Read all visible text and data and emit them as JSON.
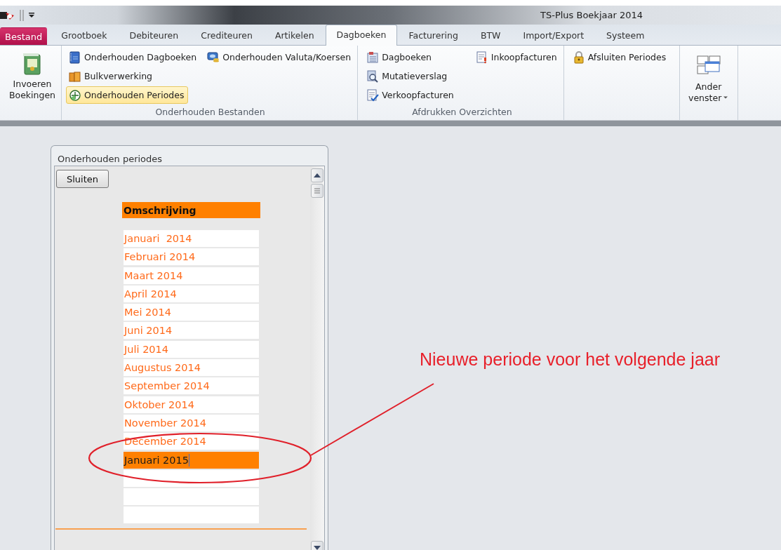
{
  "window": {
    "title": "TS-Plus Boekjaar 2014"
  },
  "ribbon": {
    "tabs": [
      {
        "label": "Bestand",
        "kind": "file",
        "selected": false
      },
      {
        "label": "Grootboek",
        "kind": "tab",
        "selected": false
      },
      {
        "label": "Debiteuren",
        "kind": "tab",
        "selected": false
      },
      {
        "label": "Crediteuren",
        "kind": "tab",
        "selected": false
      },
      {
        "label": "Artikelen",
        "kind": "tab",
        "selected": false
      },
      {
        "label": "Dagboeken",
        "kind": "tab",
        "selected": true
      },
      {
        "label": "Facturering",
        "kind": "tab",
        "selected": false
      },
      {
        "label": "BTW",
        "kind": "tab",
        "selected": false
      },
      {
        "label": "Import/Export",
        "kind": "tab",
        "selected": false
      },
      {
        "label": "Systeem",
        "kind": "tab",
        "selected": false
      }
    ],
    "groups": [
      {
        "items": [
          {
            "kind": "large",
            "label": "Invoeren Boekingen",
            "dropdown": false
          }
        ]
      },
      {
        "label": "Onderhouden Bestanden",
        "items": [
          {
            "kind": "small",
            "label": "Onderhouden Dagboeken",
            "highlighted": false
          },
          {
            "kind": "small",
            "label": "Bulkverwerking",
            "highlighted": false
          },
          {
            "kind": "small",
            "label": "Onderhouden Periodes",
            "highlighted": true
          },
          {
            "kind": "small",
            "label": "Onderhouden Valuta/Koersen",
            "highlighted": false
          }
        ]
      },
      {
        "label": "Afdrukken Overzichten",
        "items": [
          {
            "kind": "small",
            "label": "Dagboeken",
            "highlighted": false
          },
          {
            "kind": "small",
            "label": "Mutatieverslag",
            "highlighted": false
          },
          {
            "kind": "small",
            "label": "Verkoopfacturen",
            "highlighted": false
          },
          {
            "kind": "small",
            "label": "Inkoopfacturen",
            "highlighted": false
          }
        ]
      },
      {
        "items": [
          {
            "kind": "small",
            "label": "Afsluiten Periodes",
            "highlighted": false
          }
        ]
      },
      {
        "items": [
          {
            "kind": "large",
            "label": "Ander venster",
            "dropdown": true
          }
        ]
      }
    ]
  },
  "panel": {
    "title": "Onderhouden periodes",
    "close_button": "Sluiten",
    "column_header": "Omschrijving",
    "periods": [
      {
        "text": "Januari  2014",
        "selected": false
      },
      {
        "text": "Februari 2014",
        "selected": false
      },
      {
        "text": "Maart 2014",
        "selected": false
      },
      {
        "text": "April 2014",
        "selected": false
      },
      {
        "text": "Mei 2014",
        "selected": false
      },
      {
        "text": "Juni 2014",
        "selected": false
      },
      {
        "text": "Juli 2014",
        "selected": false
      },
      {
        "text": "Augustus 2014",
        "selected": false
      },
      {
        "text": "September 2014",
        "selected": false
      },
      {
        "text": "Oktober 2014",
        "selected": false
      },
      {
        "text": "November 2014",
        "selected": false
      },
      {
        "text": "December 2014",
        "selected": false
      },
      {
        "text": "Januari 2015",
        "selected": true
      }
    ]
  },
  "annotation": {
    "text": "Nieuwe periode voor het volgende jaar"
  }
}
